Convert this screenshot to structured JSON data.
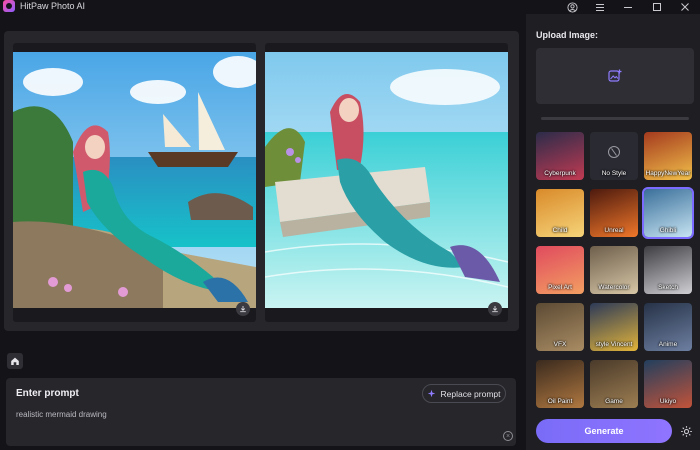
{
  "app": {
    "title": "HitPaw Photo AI"
  },
  "titlebar": {
    "icons": [
      "account-icon",
      "menu-icon",
      "minimize-icon",
      "maximize-icon",
      "close-icon"
    ]
  },
  "canvas": {
    "images": [
      {
        "name": "result-image-1",
        "description_icon": "download-icon"
      },
      {
        "name": "result-image-2",
        "description_icon": "download-icon"
      }
    ]
  },
  "prompt": {
    "label": "Enter prompt",
    "replace_label": "Replace prompt",
    "text": "realistic mermaid drawing"
  },
  "sidebar": {
    "upload_label": "Upload Image:",
    "styles": [
      {
        "label": "Cyberpunk",
        "colors": [
          "#2b2c4a",
          "#c23a52"
        ]
      },
      {
        "label": "No Style",
        "colors": [
          "#2a2a33",
          "#2a2a33"
        ]
      },
      {
        "label": "HappyNewYear",
        "colors": [
          "#a43a1e",
          "#f2c04a"
        ]
      },
      {
        "label": "Child",
        "colors": [
          "#d98a2a",
          "#f6d479"
        ]
      },
      {
        "label": "Unreal",
        "colors": [
          "#4d1a0e",
          "#f0772a"
        ]
      },
      {
        "label": "Ghibli",
        "colors": [
          "#3a6f9a",
          "#c7e4f2"
        ]
      },
      {
        "label": "Pixel Art",
        "colors": [
          "#e04a5e",
          "#f39f62"
        ]
      },
      {
        "label": "Watercolor",
        "colors": [
          "#6e5f4c",
          "#d7c6a6"
        ]
      },
      {
        "label": "Sketch",
        "colors": [
          "#3e3e42",
          "#cfcfd4"
        ]
      },
      {
        "label": "VFX",
        "colors": [
          "#5c4a34",
          "#a98c63"
        ]
      },
      {
        "label": "style Vincent",
        "colors": [
          "#2d3a58",
          "#e2b43a"
        ]
      },
      {
        "label": "Anime",
        "colors": [
          "#263247",
          "#6d7fa1"
        ]
      },
      {
        "label": "Oil Paint",
        "colors": [
          "#3a2a1e",
          "#b07840"
        ]
      },
      {
        "label": "Game",
        "colors": [
          "#4a3a2a",
          "#9d7e52"
        ]
      },
      {
        "label": "Ukiyo",
        "colors": [
          "#223f5e",
          "#c2533a"
        ]
      }
    ],
    "selected_style": "Ghibli",
    "generate_label": "Generate"
  },
  "colors": {
    "accent": "#7b6cff",
    "bg": "#141418",
    "panel": "#26262b"
  }
}
